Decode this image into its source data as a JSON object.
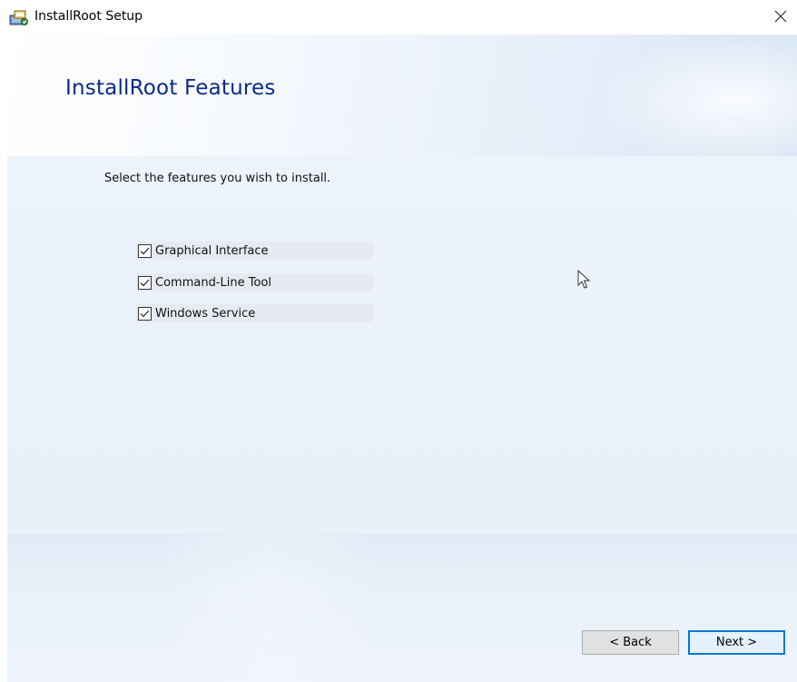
{
  "window": {
    "title": "InstallRoot Setup",
    "icon": "installer-icon",
    "close_icon": "close-icon"
  },
  "header": {
    "title": "InstallRoot Features"
  },
  "main": {
    "instruction": "Select the features you wish to install.",
    "features": [
      {
        "label": "Graphical Interface",
        "checked": true
      },
      {
        "label": "Command-Line Tool",
        "checked": true
      },
      {
        "label": "Windows Service",
        "checked": true
      }
    ]
  },
  "footer": {
    "back_label": "< Back",
    "next_label": "Next >"
  },
  "colors": {
    "title_blue": "#0b2a8a",
    "focus_blue": "#0078d7",
    "body_bg": "#e8f0fa"
  }
}
